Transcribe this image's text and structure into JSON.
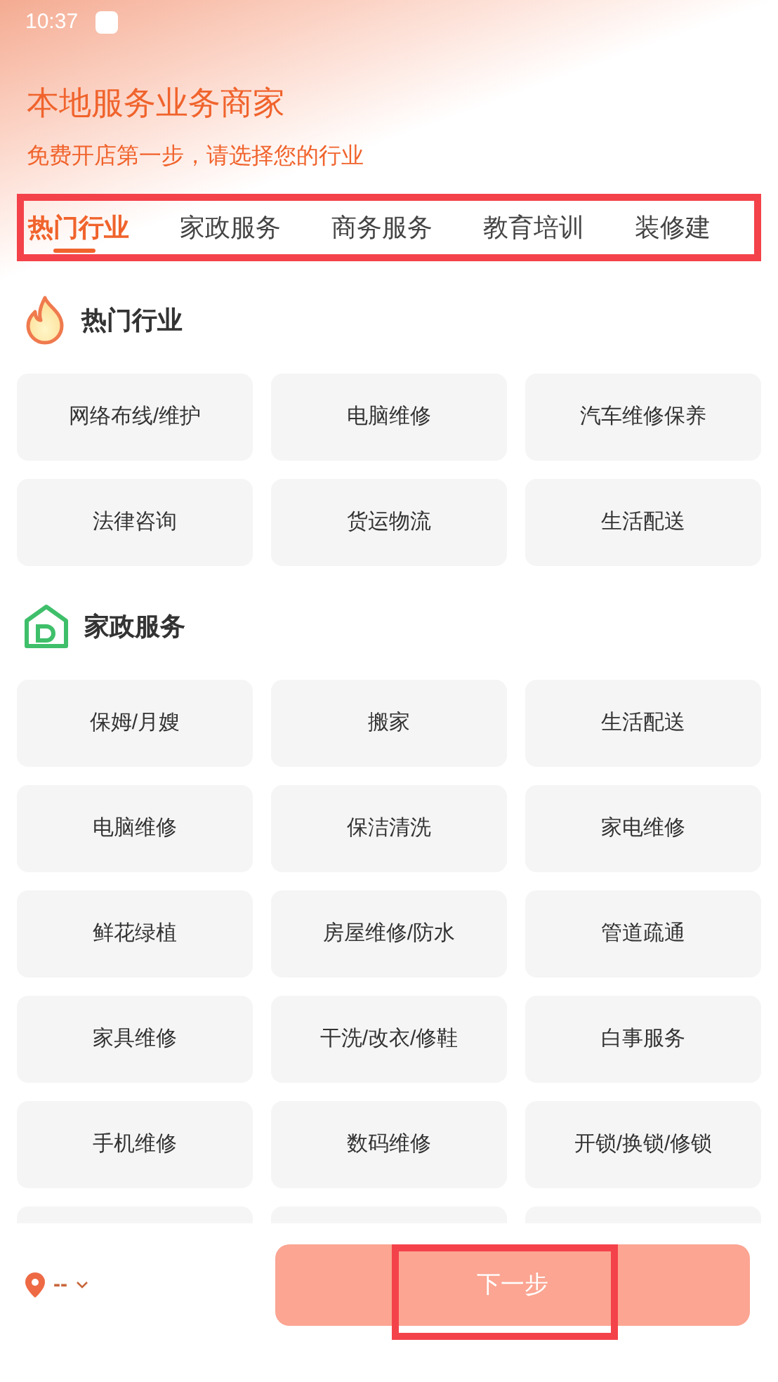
{
  "status_bar": {
    "time": "10:37"
  },
  "header": {
    "title": "本地服务业务商家",
    "subtitle": "免费开店第一步，请选择您的行业"
  },
  "tabs": {
    "highlighted": true,
    "items": [
      {
        "label": "热门行业",
        "selected": true
      },
      {
        "label": "家政服务",
        "selected": false
      },
      {
        "label": "商务服务",
        "selected": false
      },
      {
        "label": "教育培训",
        "selected": false
      },
      {
        "label": "装修建",
        "selected": false
      }
    ]
  },
  "sections": [
    {
      "kind": "fire",
      "title": "热门行业",
      "items": [
        "网络布线/维护",
        "电脑维修",
        "汽车维修保养",
        "法律咨询",
        "货运物流",
        "生活配送"
      ]
    },
    {
      "kind": "house",
      "title": "家政服务",
      "items": [
        "保姆/月嫂",
        "搬家",
        "生活配送",
        "电脑维修",
        "保洁清洗",
        "家电维修",
        "鲜花绿植",
        "房屋维修/防水",
        "管道疏通",
        "家具维修",
        "干洗/改衣/修鞋",
        "白事服务",
        "手机维修",
        "数码维修",
        "开锁/换锁/修锁"
      ]
    }
  ],
  "bottom_bar": {
    "location": "--",
    "next_button": {
      "label": "下一步",
      "disabled": true,
      "highlighted": true
    }
  }
}
